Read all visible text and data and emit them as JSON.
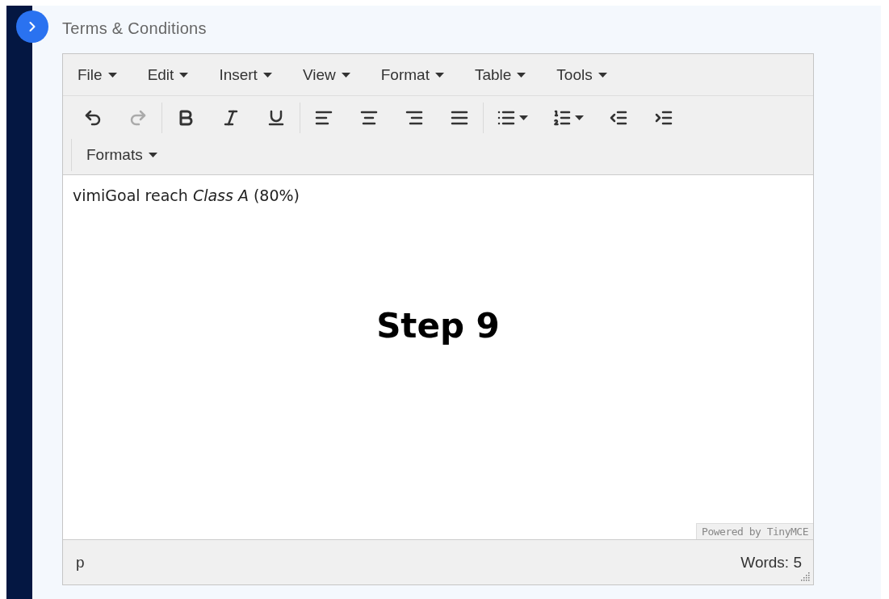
{
  "section": {
    "title": "Terms & Conditions"
  },
  "editor": {
    "menubar": [
      {
        "label": "File"
      },
      {
        "label": "Edit"
      },
      {
        "label": "Insert"
      },
      {
        "label": "View"
      },
      {
        "label": "Format"
      },
      {
        "label": "Table"
      },
      {
        "label": "Tools"
      }
    ],
    "toolbar": [
      [
        {
          "kind": "undo",
          "disabled": false
        },
        {
          "kind": "redo",
          "disabled": true
        }
      ],
      [
        {
          "kind": "bold",
          "disabled": false
        },
        {
          "kind": "italic",
          "disabled": false
        },
        {
          "kind": "underline",
          "disabled": false
        }
      ],
      [
        {
          "kind": "align-left",
          "disabled": false
        },
        {
          "kind": "align-center",
          "disabled": false
        },
        {
          "kind": "align-right",
          "disabled": false
        },
        {
          "kind": "align-justify",
          "disabled": false
        }
      ],
      [
        {
          "kind": "bullet-list",
          "disabled": false
        },
        {
          "kind": "numbered-list",
          "disabled": false
        },
        {
          "kind": "outdent",
          "disabled": false
        },
        {
          "kind": "indent",
          "disabled": false
        }
      ]
    ],
    "formats": {
      "label": "Formats"
    },
    "content": "vimiGoal reach *Class A* (80%)",
    "overlay_label": "Step 9",
    "branding": "Powered by TinyMCE",
    "path": "p",
    "word_count": "Words: 5"
  }
}
